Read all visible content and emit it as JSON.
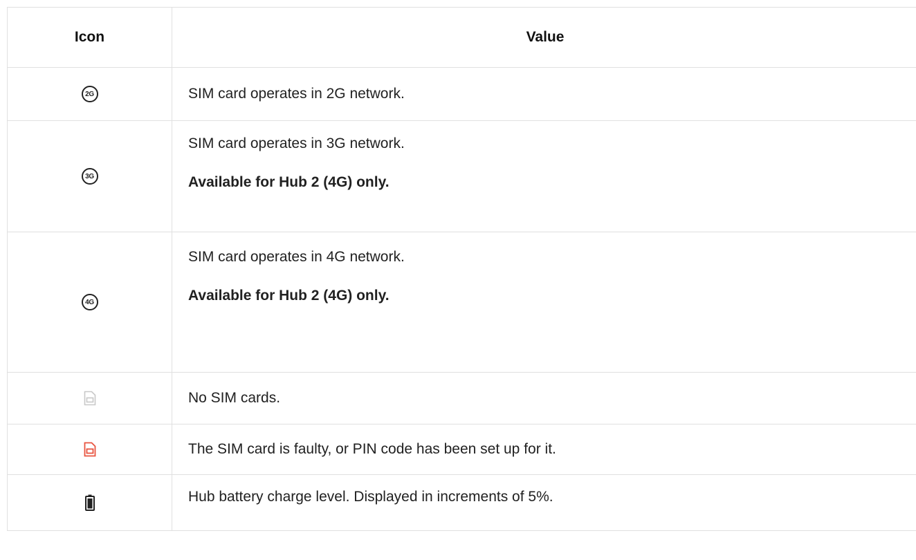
{
  "table": {
    "headers": {
      "icon": "Icon",
      "value": "Value"
    },
    "rows": [
      {
        "icon": "2g-icon",
        "icon_text": "2G",
        "text": "SIM card operates in 2G network."
      },
      {
        "icon": "3g-icon",
        "icon_text": "3G",
        "text": "SIM card operates in 3G network.",
        "note": "Available for Hub 2 (4G) only."
      },
      {
        "icon": "4g-icon",
        "icon_text": "4G",
        "text": "SIM card operates in 4G network.",
        "note": "Available for Hub 2 (4G) only."
      },
      {
        "icon": "no-sim-icon",
        "text": "No SIM cards."
      },
      {
        "icon": "faulty-sim-icon",
        "text": "The SIM card is faulty, or PIN code has been set up for it."
      },
      {
        "icon": "battery-icon",
        "text": "Hub battery charge level. Displayed in increments of 5%."
      }
    ]
  },
  "colors": {
    "border": "#e0e0e0",
    "sim_inactive": "#c8c8c8",
    "sim_faulty": "#e8533f",
    "icon_dark": "#222222"
  }
}
